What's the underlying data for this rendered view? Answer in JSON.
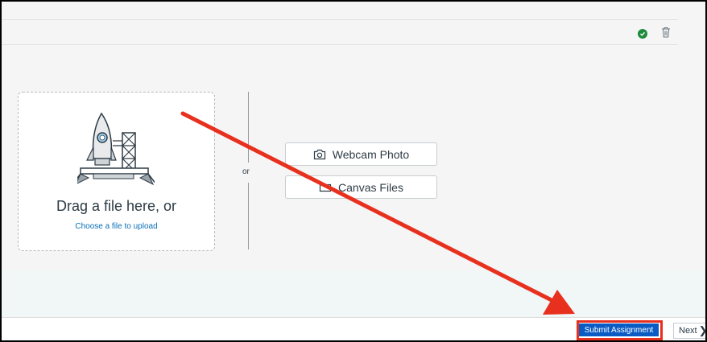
{
  "upload": {
    "drag_text": "Drag a file here, or",
    "choose_link": "Choose a file to upload",
    "or_text": "or"
  },
  "options": {
    "webcam_label": "Webcam Photo",
    "canvas_label": "Canvas Files"
  },
  "footer": {
    "submit_label": "Submit Assignment",
    "next_label": "Next"
  },
  "icons": {
    "status": "check-circle-icon",
    "trash": "trash-icon",
    "webcam": "camera-icon",
    "canvas": "folder-icon",
    "rocket": "rocket-illustration",
    "next": "chevron-right-icon"
  },
  "colors": {
    "accent": "#0a5cc4",
    "link": "#0a6fb5",
    "status_ok": "#1f8a3c",
    "annotation": "#e8301e"
  }
}
